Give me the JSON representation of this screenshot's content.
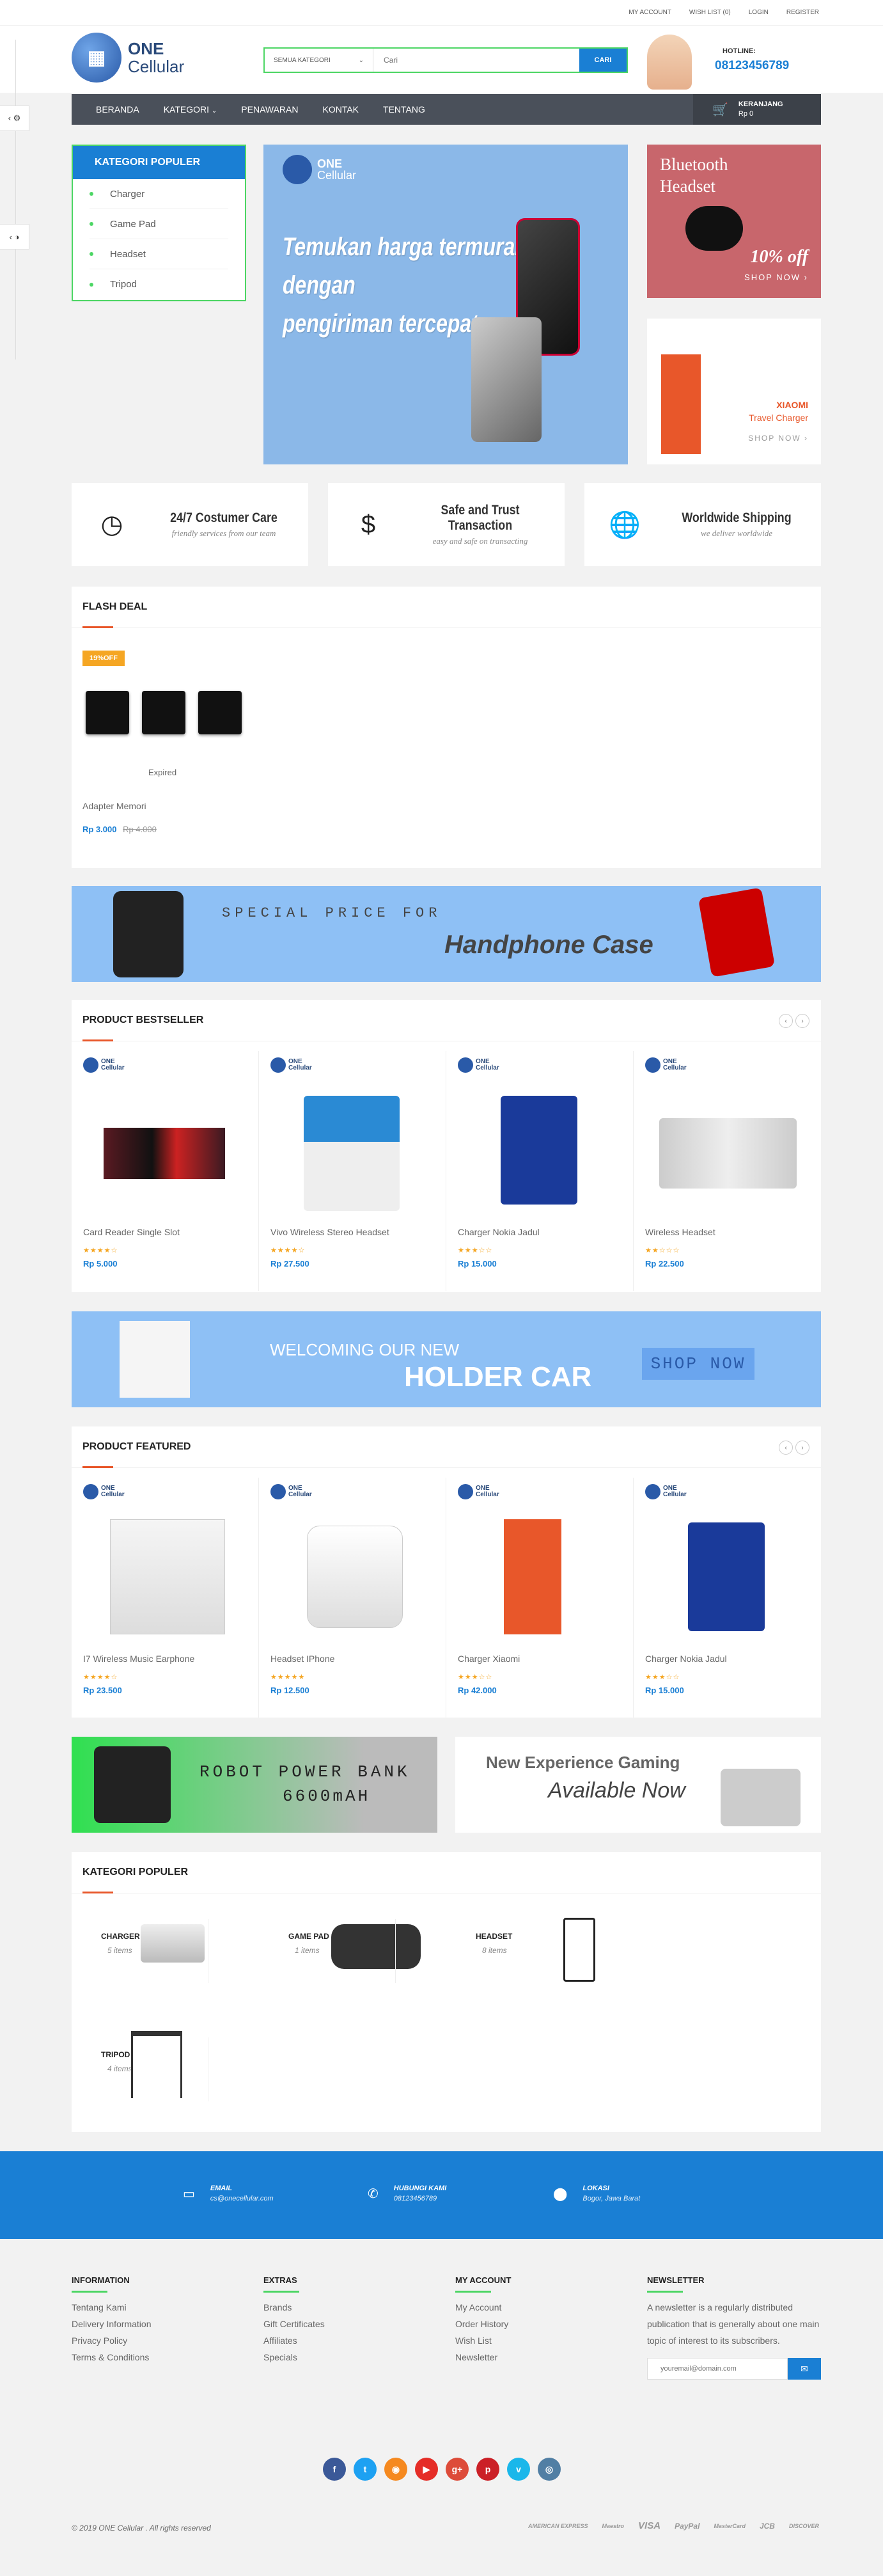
{
  "top": {
    "links": [
      "MY ACCOUNT",
      "WISH LIST (0)",
      "LOGIN",
      "REGISTER"
    ]
  },
  "logo": {
    "line1": "ONE",
    "line2": "Cellular"
  },
  "search": {
    "category": "SEMUA KATEGORI",
    "placeholder": "Cari",
    "button": "CARI"
  },
  "hotline": {
    "label": "HOTLINE:",
    "number": "08123456789"
  },
  "nav": {
    "items": [
      "BERANDA",
      "KATEGORI",
      "PENAWARAN",
      "KONTAK",
      "TENTANG"
    ],
    "cart_label": "KERANJANG",
    "cart_total": "Rp 0"
  },
  "sidebar": {
    "title": "KATEGORI POPULER",
    "items": [
      "Charger",
      "Game Pad",
      "Headset",
      "Tripod"
    ]
  },
  "hero": {
    "logo1": "ONE",
    "logo2": "Cellular",
    "line1": "Temukan harga termurah",
    "line2": "dengan",
    "line3": "pengiriman tercepat"
  },
  "banner_bt": {
    "t1": "Bluetooth",
    "t2": "Headset",
    "off": "10% off",
    "cta": "SHOP NOW"
  },
  "banner_xi": {
    "t1": "XIAOMI",
    "t2": "Travel Charger",
    "cta": "SHOP NOW"
  },
  "features": [
    {
      "title": "24/7 Costumer Care",
      "sub": "friendly services from our team"
    },
    {
      "title": "Safe and Trust Transaction",
      "sub": "easy and safe on transacting"
    },
    {
      "title": "Worldwide Shipping",
      "sub": "we deliver worldwide"
    }
  ],
  "flash": {
    "title": "FLASH DEAL",
    "badge": "19%OFF",
    "status": "Expired",
    "name": "Adapter Memori",
    "price": "Rp 3.000",
    "old": "Rp 4.000"
  },
  "promo1": {
    "t1": "SPECIAL PRICE FOR",
    "t2": "Handphone Case"
  },
  "bestseller": {
    "title": "PRODUCT BESTSELLER",
    "items": [
      {
        "name": "Card Reader Single Slot",
        "price": "Rp 5.000",
        "stars": "★★★★☆"
      },
      {
        "name": "Vivo Wireless Stereo Headset",
        "price": "Rp 27.500",
        "stars": "★★★★☆"
      },
      {
        "name": "Charger Nokia Jadul",
        "price": "Rp 15.000",
        "stars": "★★★☆☆"
      },
      {
        "name": "Wireless Headset",
        "price": "Rp 22.500",
        "stars": "★★☆☆☆"
      }
    ]
  },
  "promo2": {
    "t1": "WELCOMING OUR NEW",
    "t2": "HOLDER CAR",
    "cta": "SHOP NOW"
  },
  "featured": {
    "title": "PRODUCT FEATURED",
    "items": [
      {
        "name": "I7 Wireless Music Earphone",
        "price": "Rp 23.500",
        "stars": "★★★★☆"
      },
      {
        "name": "Headset IPhone",
        "price": "Rp 12.500",
        "stars": "★★★★★"
      },
      {
        "name": "Charger Xiaomi",
        "price": "Rp 42.000",
        "stars": "★★★☆☆"
      },
      {
        "name": "Charger Nokia Jadul",
        "price": "Rp 15.000",
        "stars": "★★★☆☆"
      }
    ]
  },
  "promo3": {
    "t1": "ROBOT POWER BANK",
    "t2": "6600mAH"
  },
  "promo4": {
    "t1": "New Experience Gaming",
    "t2": "Available Now"
  },
  "kategori": {
    "title": "KATEGORI POPULER",
    "items": [
      {
        "name": "CHARGER",
        "count": "5 items"
      },
      {
        "name": "GAME PAD",
        "count": "1 items"
      },
      {
        "name": "HEADSET",
        "count": "8 items"
      },
      {
        "name": "TRIPOD",
        "count": "4 items"
      }
    ]
  },
  "contact": {
    "email_label": "EMAIL",
    "email": "cs@onecellular.com",
    "phone_label": "HUBUNGI KAMI",
    "phone": "08123456789",
    "loc_label": "LOKASI",
    "loc": "Bogor, Jawa Barat"
  },
  "footer": {
    "info_title": "INFORMATION",
    "info": [
      "Tentang Kami",
      "Delivery Information",
      "Privacy Policy",
      "Terms & Conditions"
    ],
    "extras_title": "EXTRAS",
    "extras": [
      "Brands",
      "Gift Certificates",
      "Affiliates",
      "Specials"
    ],
    "account_title": "MY ACCOUNT",
    "account": [
      "My Account",
      "Order History",
      "Wish List",
      "Newsletter"
    ],
    "news_title": "NEWSLETTER",
    "news_text": "A newsletter is a regularly distributed publication that is generally about one main topic of interest to its subscribers.",
    "news_placeholder": "youremail@domain.com"
  },
  "copyright": "© 2019 ONE Cellular . All rights reserved",
  "payments": [
    "AMERICAN EXPRESS",
    "Maestro",
    "VISA",
    "PayPal",
    "MasterCard",
    "JCB",
    "DISCOVER"
  ]
}
